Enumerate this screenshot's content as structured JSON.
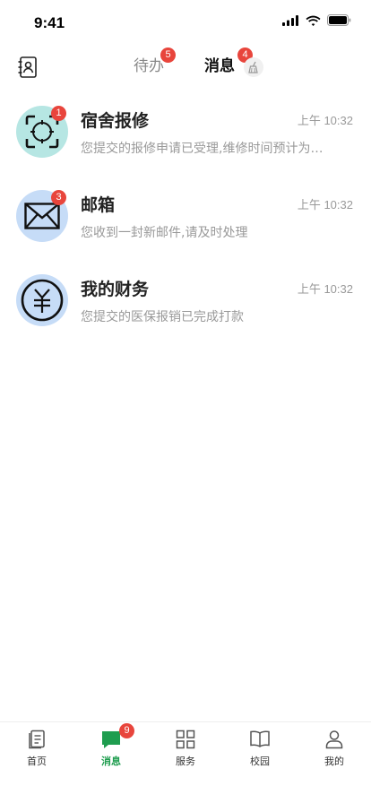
{
  "status_bar": {
    "time": "9:41"
  },
  "header": {
    "tabs": [
      {
        "label": "待办",
        "badge": "5"
      },
      {
        "label": "消息",
        "badge": "4"
      }
    ]
  },
  "messages": [
    {
      "title": "宿舍报修",
      "time": "上午 10:32",
      "preview": "您提交的报修申请已受理,维修时间预计为…",
      "badge": "1",
      "icon": "repair-target-icon"
    },
    {
      "title": "邮箱",
      "time": "上午 10:32",
      "preview": "您收到一封新邮件,请及时处理",
      "badge": "3",
      "icon": "mail-envelope-icon"
    },
    {
      "title": "我的财务",
      "time": "上午 10:32",
      "preview": "您提交的医保报销已完成打款",
      "badge": "",
      "icon": "yuan-coin-icon"
    }
  ],
  "tabbar": {
    "items": [
      {
        "label": "首页",
        "icon": "home-document-icon"
      },
      {
        "label": "消息",
        "icon": "chat-bubble-icon",
        "badge": "9"
      },
      {
        "label": "服务",
        "icon": "grid-icon"
      },
      {
        "label": "校园",
        "icon": "open-book-icon"
      },
      {
        "label": "我的",
        "icon": "person-icon"
      }
    ]
  },
  "colors": {
    "accent": "#1f9d4f",
    "badge": "#e8453c",
    "teal_avatar": "#b6e6e3",
    "blue_avatar": "#c6dcf7"
  }
}
